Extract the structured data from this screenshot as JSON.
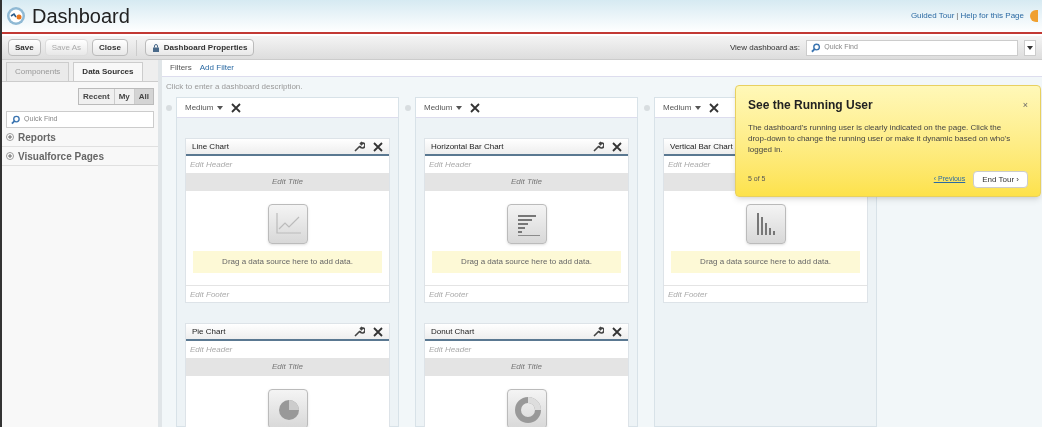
{
  "header": {
    "title": "Dashboard",
    "links": [
      "Guided Tour",
      "|",
      "Help for this Page"
    ]
  },
  "toolbar": {
    "buttons": [
      {
        "label": "Save",
        "disabled": false
      },
      {
        "label": "Save As",
        "disabled": true
      },
      {
        "label": "Close",
        "disabled": false
      }
    ],
    "properties_button": "Dashboard Properties",
    "view_as_label": "View dashboard as:",
    "view_as_placeholder": "Quick Find"
  },
  "sidebar": {
    "tabs": [
      {
        "label": "Components",
        "selected": false
      },
      {
        "label": "Data Sources",
        "selected": true
      }
    ],
    "filters": [
      {
        "label": "Recent",
        "selected": false
      },
      {
        "label": "My",
        "selected": false
      },
      {
        "label": "All",
        "selected": true
      }
    ],
    "search_placeholder": "Quick Find",
    "items": [
      {
        "label": "Reports",
        "expanded": false
      },
      {
        "label": "Visualforce Pages",
        "expanded": false
      }
    ]
  },
  "filters": {
    "label": "Filters",
    "add_link": "Add Filter"
  },
  "description_placeholder": "Click to enter a dashboard description.",
  "columns": [
    {
      "size": "Medium",
      "widgets": [
        {
          "kind": "line",
          "title": "Line Chart",
          "header": "Edit Header",
          "chart_title": "Edit Title",
          "message": "Drag a data source here to add data.",
          "footer": "Edit Footer"
        },
        {
          "kind": "pie",
          "title": "Pie Chart",
          "header": "Edit Header",
          "chart_title": "Edit Title"
        }
      ]
    },
    {
      "size": "Medium",
      "widgets": [
        {
          "kind": "hbar",
          "title": "Horizontal Bar Chart",
          "header": "Edit Header",
          "chart_title": "Edit Title",
          "message": "Drag a data source here to add data.",
          "footer": "Edit Footer"
        },
        {
          "kind": "donut",
          "title": "Donut Chart",
          "header": "Edit Header",
          "chart_title": "Edit Title"
        }
      ]
    },
    {
      "size": "Medium",
      "widgets": [
        {
          "kind": "vbar",
          "title": "Vertical Bar Chart",
          "header": "Edit Header",
          "message": "Drag a data source here to add data.",
          "footer": "Edit Footer"
        }
      ]
    }
  ],
  "tour": {
    "title": "See the Running User",
    "body": "The dashboard's running user is clearly indicated on the page. Click the drop-down to change the running user or make it dynamic based on who's logged in.",
    "close": "×",
    "step": "5 of 5",
    "previous": "‹ Previous",
    "end": "End Tour ›"
  }
}
